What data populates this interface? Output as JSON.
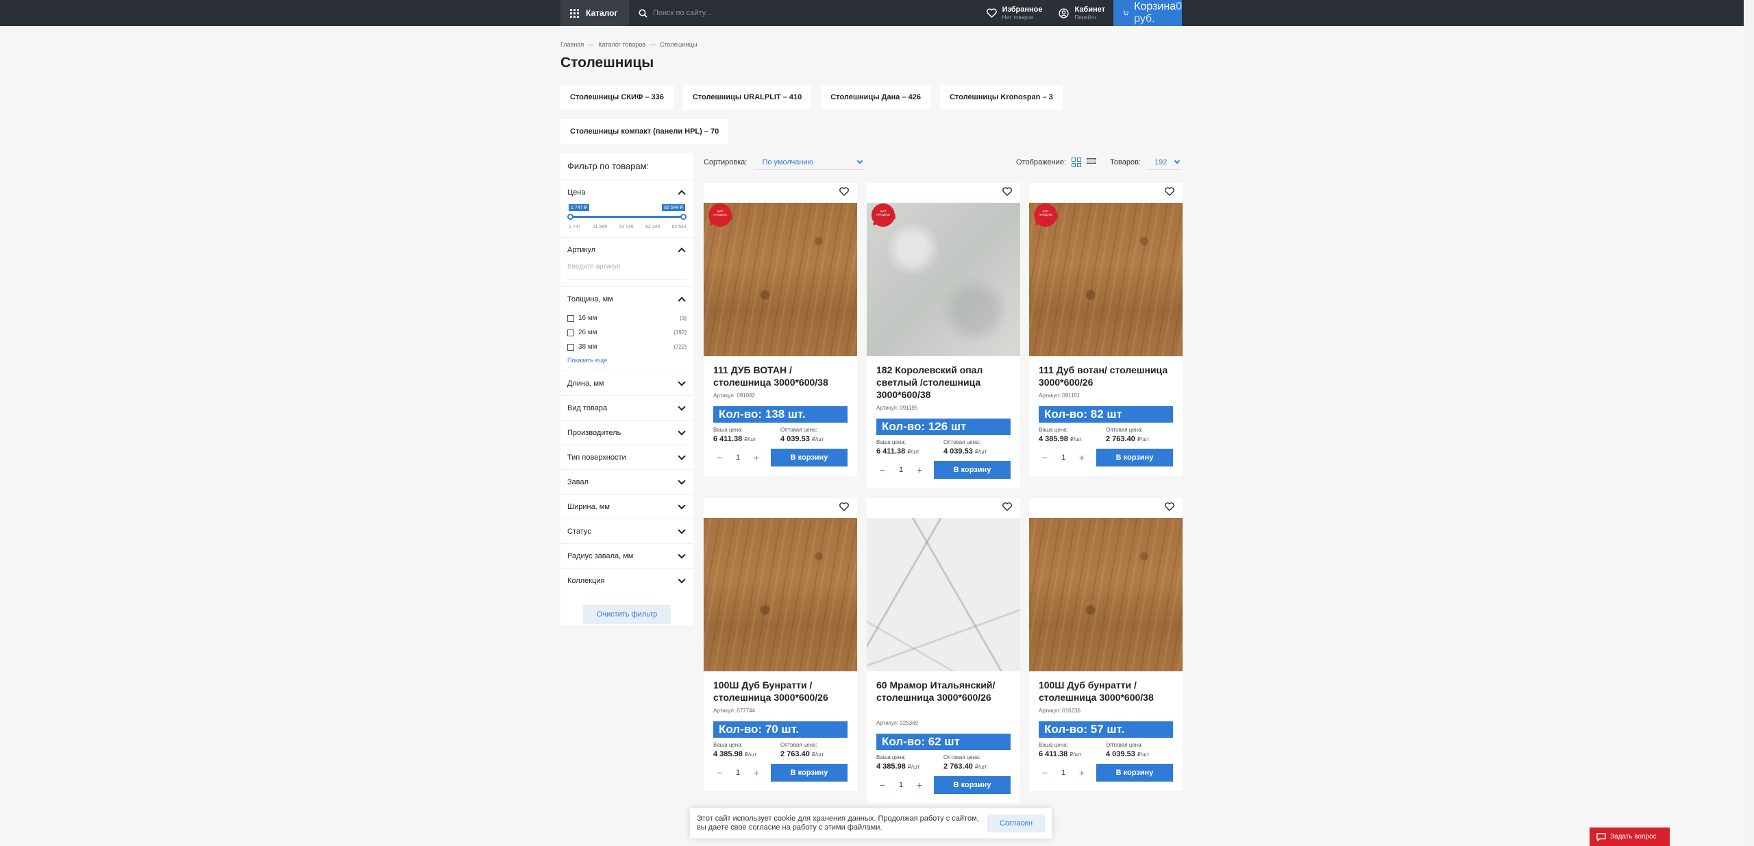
{
  "header": {
    "catalog_label": "Каталог",
    "search_placeholder": "Поиск по сайту...",
    "favorites": {
      "title": "Избранное",
      "sub": "Нет товаров"
    },
    "cabinet": {
      "title": "Кабинет",
      "sub": "Перейти"
    },
    "cart": {
      "title": "Корзина",
      "sub": "0 руб."
    }
  },
  "breadcrumb": [
    "Главная",
    "Каталог товаров",
    "Столешницы"
  ],
  "breadcrumb_sep": "—",
  "page_title": "Столешницы",
  "subcategories": [
    "Столешницы СКИФ – 336",
    "Столешницы URALPLIT – 410",
    "Столешницы Дана – 426",
    "Столешницы Kronospan – 3",
    "Столешницы компакт (панели HPL) – 70"
  ],
  "filter": {
    "title": "Фильтр по товарам:",
    "price": {
      "label": "Цена",
      "min_tag": "1 747 ₽",
      "max_tag": "82 544 ₽",
      "ticks": [
        "1 747",
        "21 946",
        "42 146",
        "62 345",
        "82 544"
      ]
    },
    "sku": {
      "label": "Артикул",
      "placeholder": "Введите артикул"
    },
    "thickness": {
      "label": "Толщина, мм",
      "options": [
        {
          "label": "16 мм",
          "count": "(3)"
        },
        {
          "label": "26 мм",
          "count": "(192)"
        },
        {
          "label": "38 мм",
          "count": "(722)"
        }
      ],
      "show_more": "Показать еще"
    },
    "collapsed": [
      "Длина, мм",
      "Вид товара",
      "Производитель",
      "Тип поверхности",
      "Завал",
      "Ширина, мм",
      "Статус",
      "Радиус завала, мм",
      "Коллекция"
    ],
    "clear": "Очистить фильтр"
  },
  "toolbar": {
    "sort_label": "Сортировка:",
    "sort_value": "По умолчанию",
    "display_label": "Отображение:",
    "count_label": "Товаров:",
    "count_value": "192"
  },
  "card_labels": {
    "sku_prefix": "Артикул:",
    "your_price": "Ваша цена:",
    "wholesale": "Оптовая цена:",
    "unit": "₽/шт",
    "add_to_cart": "В корзину",
    "qty": "1",
    "minus": "−",
    "plus": "+",
    "hit_line1": "ХИТ",
    "hit_line2": "ПРОДАЖ"
  },
  "products": [
    {
      "name": "111 ДУБ ВОТАН / столешница 3000*600/38",
      "sku": "Артикул: 091082",
      "stock": "Кол-во: 138 шт.",
      "price": "6 411.38",
      "wholesale": "4 039.53",
      "texture": "wood",
      "hit": true
    },
    {
      "name": "182 Королевский опал светлый /столешница 3000*600/38",
      "sku": "Артикул: 091195",
      "stock": "Кол-во: 126 шт",
      "price": "6 411.38",
      "wholesale": "4 039.53",
      "texture": "concrete",
      "hit": true
    },
    {
      "name": "111 Дуб вотан/ столешница 3000*600/26",
      "sku": "Артикул: 091151",
      "stock": "Кол-во: 82 шт",
      "price": "4 385.98",
      "wholesale": "2 763.40",
      "texture": "wood",
      "hit": true
    },
    {
      "name": "100Ш Дуб Бунратти / столешница 3000*600/26",
      "sku": "Артикул: 077744",
      "stock": "Кол-во: 70 шт.",
      "price": "4 385.98",
      "wholesale": "2 763.40",
      "texture": "wood",
      "hit": false
    },
    {
      "name": "60 Мрамор Итальянский/ столешница 3000*600/26",
      "sku": "Артикул: 025369",
      "stock": "Кол-во: 62 шт",
      "price": "4 385.98",
      "wholesale": "2 763.40",
      "texture": "marble",
      "hit": false
    },
    {
      "name": "100Ш Дуб бунратти / столешница 3000*600/38",
      "sku": "Артикул: 016236",
      "stock": "Кол-во: 57 шт.",
      "price": "6 411.38",
      "wholesale": "4 039.53",
      "texture": "wood",
      "hit": false
    }
  ],
  "cookie": {
    "text": "Этот сайт использует cookie для хранения данных. Продолжая работу с сайтом, вы даете свое согласие на работу с этими файлами.",
    "button": "Согласен"
  },
  "ask_button": "Задать вопрос",
  "colors": {
    "accent": "#2f7bd6",
    "topbar": "#2b2f36",
    "hit_red": "#d6202c"
  }
}
